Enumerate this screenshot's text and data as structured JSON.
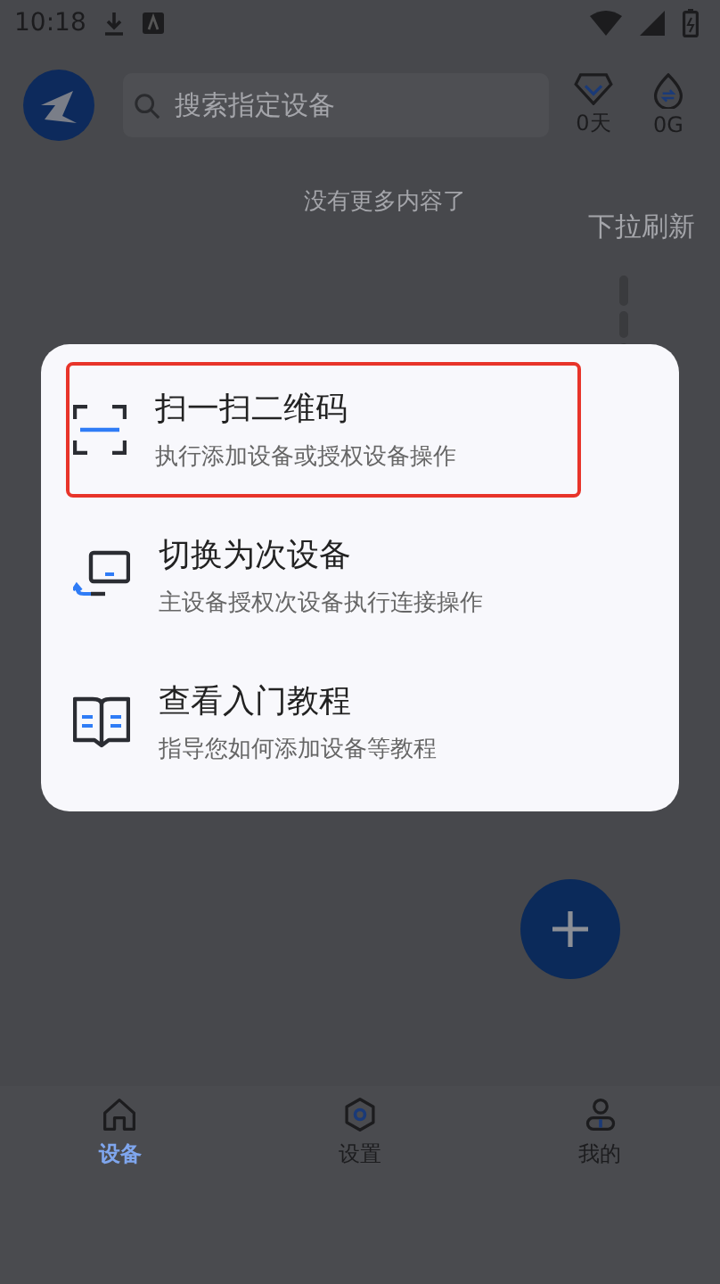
{
  "status_bar": {
    "time": "10:18"
  },
  "header": {
    "search": {
      "placeholder": "搜索指定设备"
    },
    "stats": [
      {
        "kind": "diamond",
        "value": "0天"
      },
      {
        "kind": "traffic",
        "value": "0G"
      }
    ]
  },
  "list": {
    "end_text": "没有更多内容了",
    "pull_hint": "下拉刷新"
  },
  "menu": {
    "items": [
      {
        "kind": "scan",
        "title": "扫一扫二维码",
        "subtitle": "执行添加设备或授权设备操作",
        "highlighted": true
      },
      {
        "kind": "switch",
        "title": "切换为次设备",
        "subtitle": "主设备授权次设备执行连接操作",
        "highlighted": false
      },
      {
        "kind": "guide",
        "title": "查看入门教程",
        "subtitle": "指导您如何添加设备等教程",
        "highlighted": false
      }
    ]
  },
  "tabs": [
    {
      "kind": "home",
      "label": "设备",
      "selected": true
    },
    {
      "kind": "settings",
      "label": "设置",
      "selected": false
    },
    {
      "kind": "profile",
      "label": "我的",
      "selected": false
    }
  ]
}
